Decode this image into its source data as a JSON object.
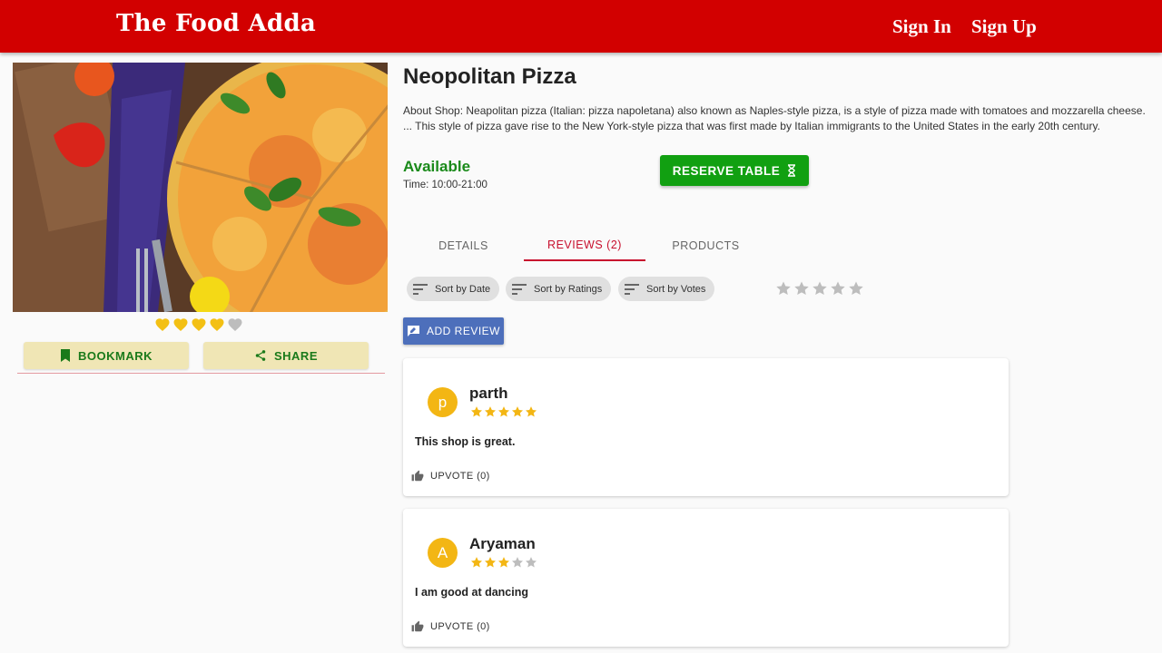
{
  "header": {
    "brand": "The Food Adda",
    "sign_in": "Sign In",
    "sign_up": "Sign Up",
    "bar_color": "#d20000"
  },
  "shop": {
    "image_icon": "pizza-photo",
    "heart_rating": 4,
    "heart_max": 5,
    "bookmark_label": "BOOKMARK",
    "share_label": "SHARE",
    "name": "Neopolitan Pizza",
    "about": "About Shop: Neapolitan pizza (Italian: pizza napoletana) also known as Naples-style pizza, is a style of pizza made with tomatoes and mozzarella cheese. ... This style of pizza gave rise to the New York-style pizza that was first made by Italian immigrants to the United States in the early 20th century.",
    "status": "Available",
    "status_color": "#1a8a1a",
    "time": "Time: 10:00-21:00",
    "reserve_label": "RESERVE TABLE"
  },
  "tabs": [
    {
      "label": "DETAILS",
      "active": false
    },
    {
      "label": "REVIEWS (2)",
      "active": true
    },
    {
      "label": "PRODUCTS",
      "active": false
    }
  ],
  "sort_chips": [
    {
      "label": "Sort by Date",
      "icon": "sort-icon"
    },
    {
      "label": "Sort by Ratings",
      "icon": "sort-icon"
    },
    {
      "label": "Sort by Votes",
      "icon": "sort-icon"
    }
  ],
  "rating_filter": {
    "value": 0,
    "max": 5
  },
  "add_review_label": "ADD REVIEW",
  "reviews": [
    {
      "initial": "p",
      "name": "parth",
      "rating": 5,
      "text": "This shop is great.",
      "upvote": "UPVOTE (0)"
    },
    {
      "initial": "A",
      "name": "Aryaman",
      "rating": 3,
      "text": "I am good at dancing",
      "upvote": "UPVOTE (0)"
    }
  ],
  "colors": {
    "accent": "#c8102e",
    "reserve": "#11a011",
    "add_review": "#4d6fbb",
    "star": "#f3b614",
    "side_button": "#f0e6b5"
  }
}
